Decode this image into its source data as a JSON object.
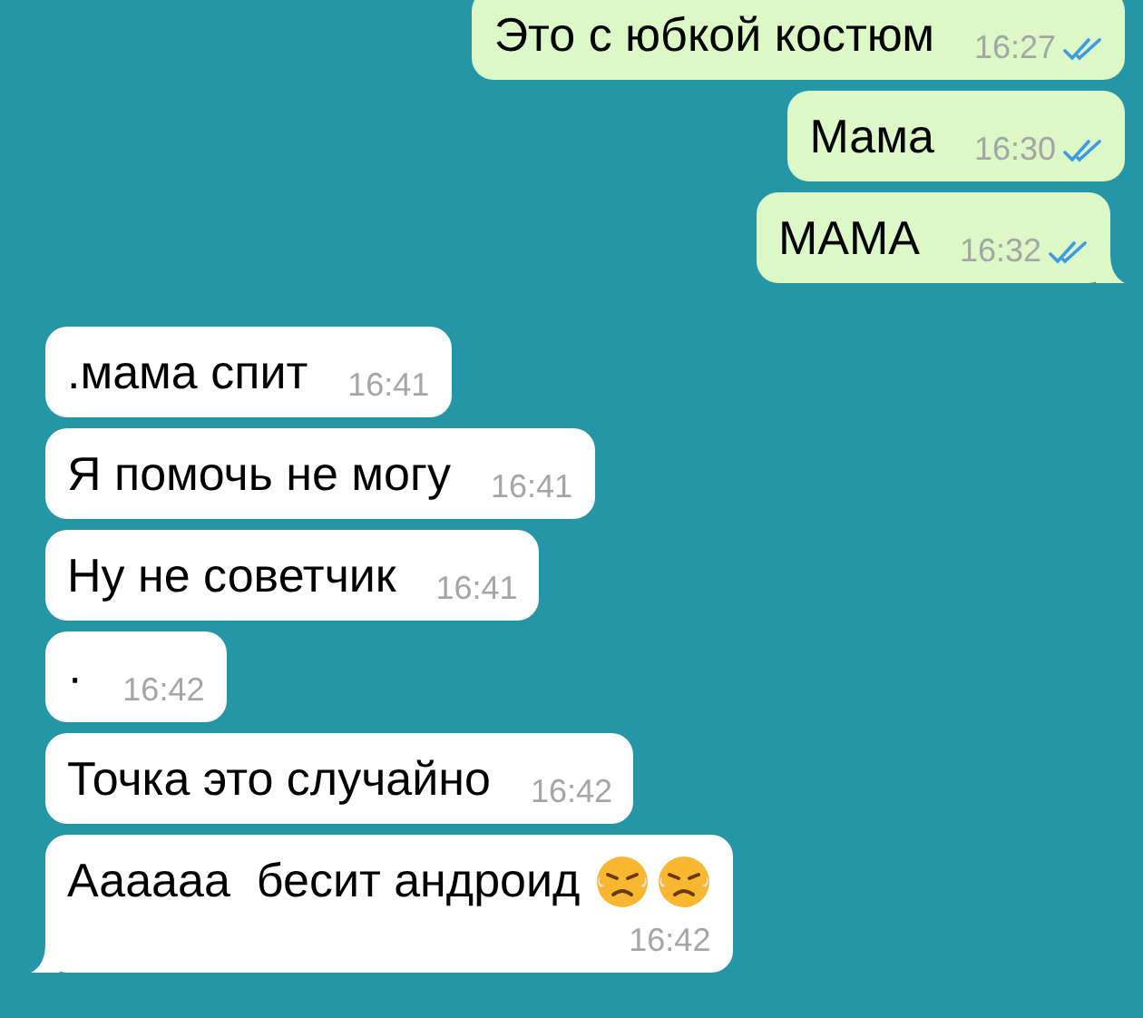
{
  "messages": [
    {
      "kind": "outgoing",
      "text": "Это с юбкой костюм",
      "time": "16:27",
      "read": true,
      "tail": false
    },
    {
      "kind": "outgoing",
      "text": "Мама",
      "time": "16:30",
      "read": true,
      "tail": false
    },
    {
      "kind": "outgoing",
      "text": "МАМА",
      "time": "16:32",
      "read": true,
      "tail": true
    },
    {
      "kind": "incoming",
      "text": ".мама спит",
      "time": "16:41",
      "tail": false
    },
    {
      "kind": "incoming",
      "text": "Я помочь не могу",
      "time": "16:41",
      "tail": false
    },
    {
      "kind": "incoming",
      "text": "Ну не советчик",
      "time": "16:41",
      "tail": false
    },
    {
      "kind": "incoming",
      "text": "·",
      "time": "16:42",
      "tail": false
    },
    {
      "kind": "incoming",
      "text": "Точка это случайно",
      "time": "16:42",
      "tail": false
    },
    {
      "kind": "incoming",
      "text": "Аааааа  бесит андроид",
      "time": "16:42",
      "tail": true,
      "emoji": [
        {
          "kind": "angry"
        },
        {
          "kind": "angry"
        }
      ]
    }
  ]
}
